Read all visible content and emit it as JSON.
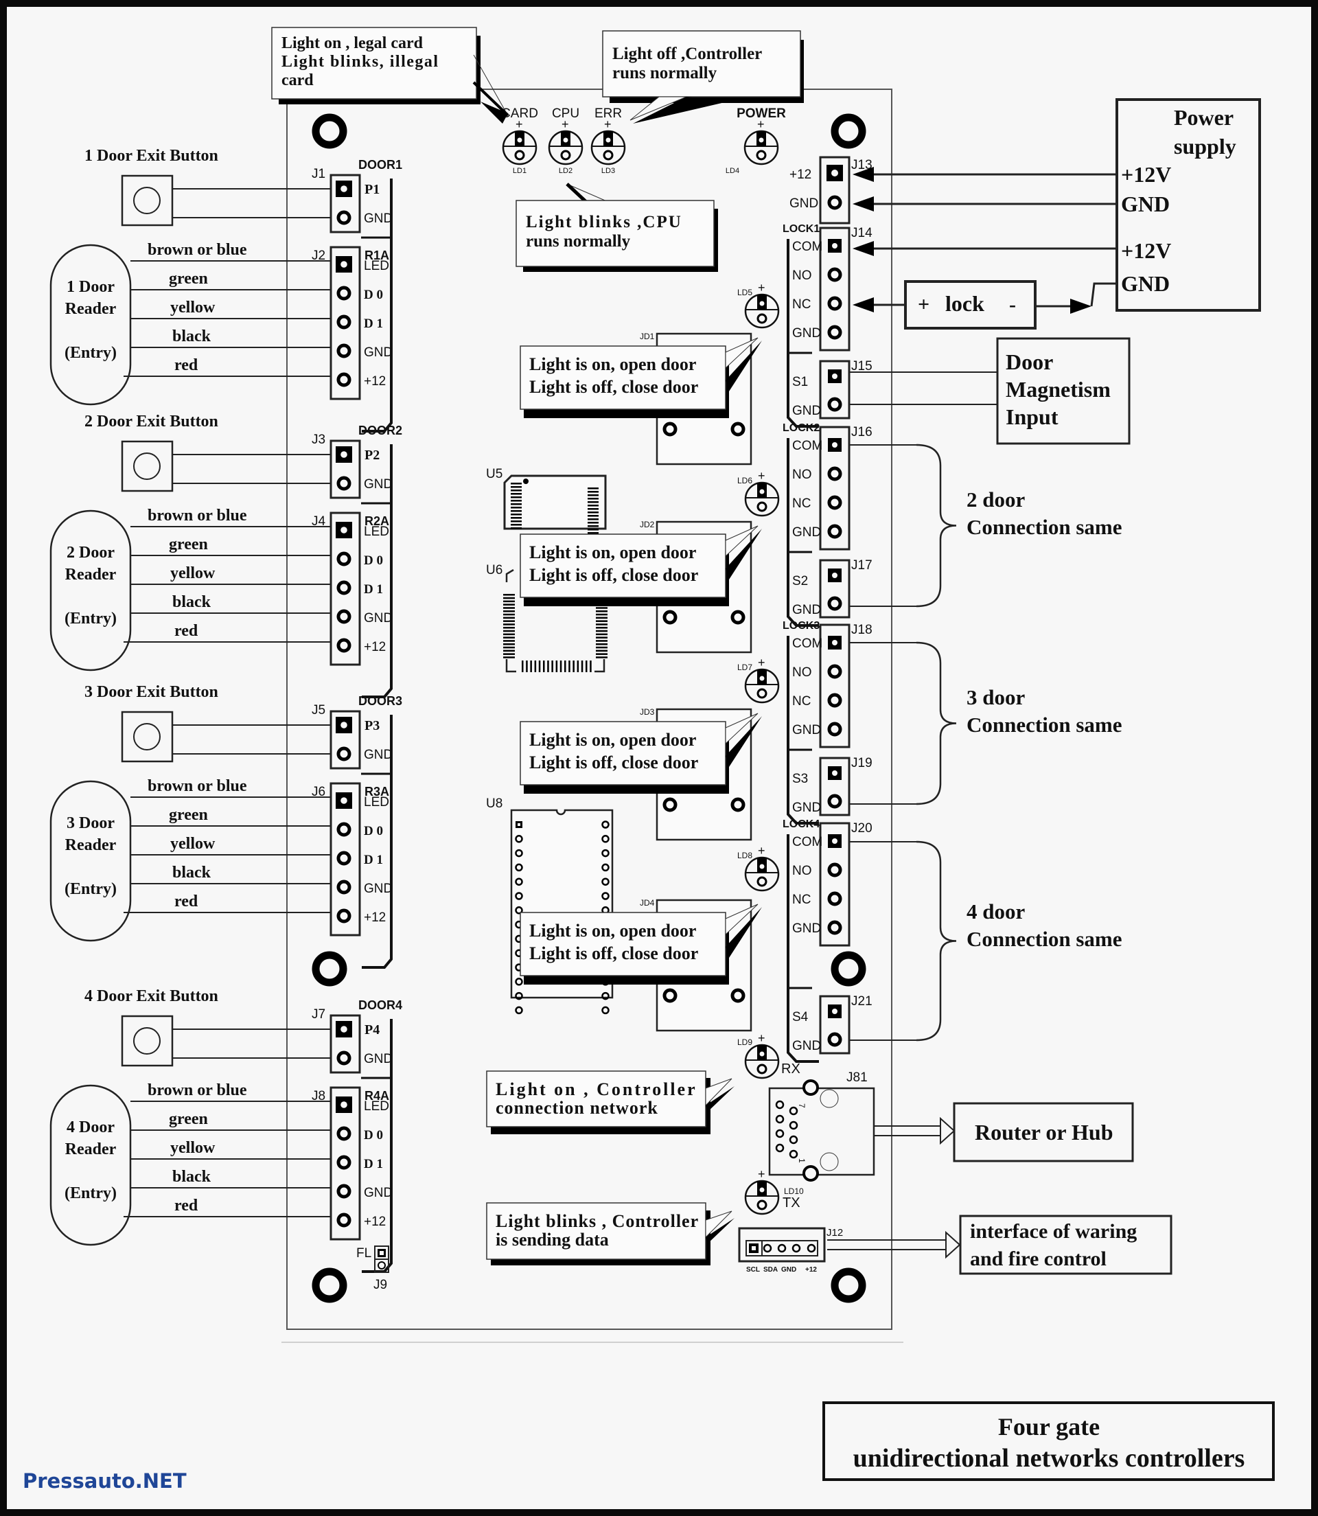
{
  "title": {
    "line1": "Four gate",
    "line2": "unidirectional networks controllers"
  },
  "watermark": "Pressauto.NET",
  "status_leds": [
    {
      "label": "CARD",
      "ref": "LD1"
    },
    {
      "label": "CPU",
      "ref": "LD2"
    },
    {
      "label": "ERR",
      "ref": "LD3"
    },
    {
      "label": "POWER",
      "ref": "LD4"
    }
  ],
  "callouts": {
    "card": [
      "Light on , legal card",
      "Light blinks, illegal",
      "card"
    ],
    "err": [
      "Light off ,Controller",
      "runs normally"
    ],
    "cpu": [
      "Light blinks ,CPU",
      "runs normally"
    ],
    "relay": [
      "Light is on, open door",
      "Light is off, close door"
    ],
    "rx": [
      "Light on , Controller",
      "connection network"
    ],
    "tx": [
      "Light blinks , Controller",
      "is sending data"
    ]
  },
  "doors": [
    {
      "exit_label": "1 Door Exit Button",
      "reader": [
        "1 Door",
        "Reader",
        "(Entry)"
      ],
      "group": "DOOR1",
      "btn_conn": "J1",
      "btn_pin": "P1",
      "reader_conn": "J2",
      "reader_tag": "R1A"
    },
    {
      "exit_label": "2 Door Exit Button",
      "reader": [
        "2 Door",
        "Reader",
        "(Entry)"
      ],
      "group": "DOOR2",
      "btn_conn": "J3",
      "btn_pin": "P2",
      "reader_conn": "J4",
      "reader_tag": "R2A"
    },
    {
      "exit_label": "3 Door Exit Button",
      "reader": [
        "3 Door",
        "Reader",
        "(Entry)"
      ],
      "group": "DOOR3",
      "btn_conn": "J5",
      "btn_pin": "P3",
      "reader_conn": "J6",
      "reader_tag": "R3A"
    },
    {
      "exit_label": "4 Door Exit Button",
      "reader": [
        "4 Door",
        "Reader",
        "(Entry)"
      ],
      "group": "DOOR4",
      "btn_conn": "J7",
      "btn_pin": "P4",
      "reader_conn": "J8",
      "reader_tag": "R4A"
    }
  ],
  "wire_colors": [
    "brown or blue",
    "green",
    "yellow",
    "black",
    "red"
  ],
  "reader_pins": [
    "LED",
    "D 0",
    "D 1",
    "GND",
    "+12"
  ],
  "gnd_label": "GND",
  "locks": [
    {
      "name": "LOCK1",
      "conn": "J14",
      "sensor_conn": "J15",
      "sensor": "S1",
      "led": "LD5",
      "relay": "JD1"
    },
    {
      "name": "LOCK2",
      "conn": "J16",
      "sensor_conn": "J17",
      "sensor": "S2",
      "led": "LD6",
      "relay": "JD2"
    },
    {
      "name": "LOCK3",
      "conn": "J18",
      "sensor_conn": "J19",
      "sensor": "S3",
      "led": "LD7",
      "relay": "JD3"
    },
    {
      "name": "LOCK4",
      "conn": "J20",
      "sensor_conn": "J21",
      "sensor": "S4",
      "led": "LD8",
      "relay": "JD4"
    }
  ],
  "lock_pins": [
    "COM",
    "NO",
    "NC",
    "GND"
  ],
  "power_conn": {
    "ref": "J13",
    "pins": [
      "+12",
      "GND"
    ]
  },
  "power_supply": {
    "title": [
      "Power",
      "supply"
    ],
    "terminals": [
      "+12V",
      "GND",
      "+12V",
      "GND"
    ]
  },
  "lock_device": {
    "plus": "+",
    "label": "lock",
    "minus": "-"
  },
  "door_magnetism": [
    "Door",
    "Magnetism",
    "Input"
  ],
  "connection_same": [
    [
      "2 door",
      "Connection same"
    ],
    [
      "3 door",
      "Connection same"
    ],
    [
      "4 door",
      "Connection same"
    ]
  ],
  "chips": [
    "U5",
    "U6",
    "U8"
  ],
  "network": {
    "rx_led": "LD9",
    "rx_label": "RX",
    "tx_led": "LD10",
    "tx_label": "TX",
    "jack": "J81",
    "pin7": "7",
    "pin1": "1",
    "router": "Router or Hub"
  },
  "alarm_port": {
    "ref": "J12",
    "pins": [
      "SCL",
      "SDA",
      "GND",
      "+12"
    ],
    "target": [
      "interface of waring",
      "and fire control"
    ]
  },
  "fire_jumper": {
    "label": "FL",
    "ref": "J9"
  }
}
